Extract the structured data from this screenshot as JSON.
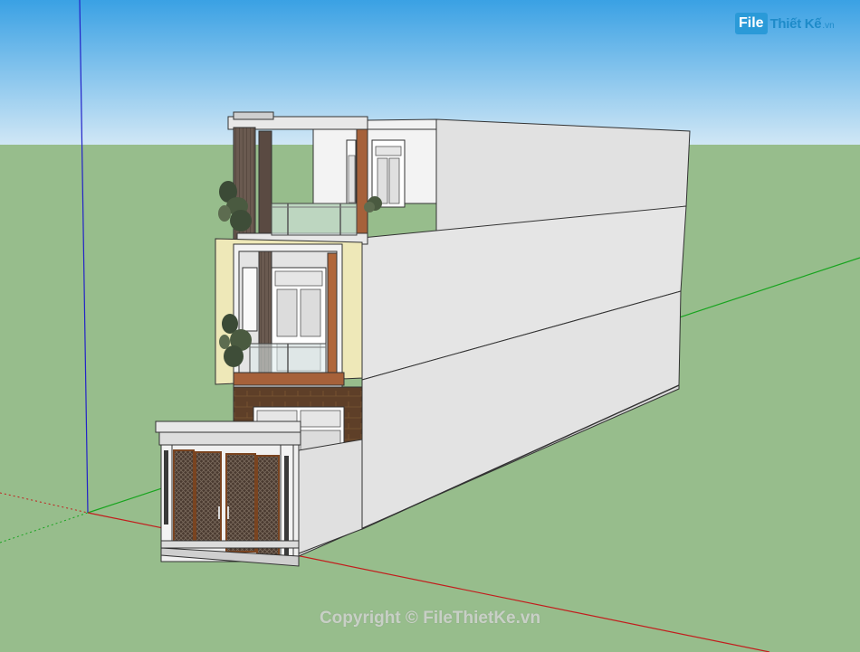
{
  "logo": {
    "badge": "File",
    "name": "Thiết Kế",
    "ext": ".vn"
  },
  "watermark": {
    "text": "Copyright © FileThietKe.vn"
  },
  "colors": {
    "sky_top": "#3aa1e4",
    "sky_bottom": "#d5e9f6",
    "ground": "#97bd8c",
    "wall_light": "#e5e5e5",
    "wall_shadow": "#cbcbcb",
    "cladding_dark": "#5a4a42",
    "cladding_brown": "#6b4226",
    "frame_cream": "#eee8b8",
    "accent_orange": "#b0663a",
    "logo_blue": "#2a9ad8"
  }
}
